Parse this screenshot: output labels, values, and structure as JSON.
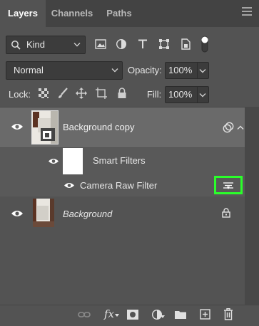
{
  "tabs": [
    {
      "label": "Layers",
      "active": true
    },
    {
      "label": "Channels",
      "active": false
    },
    {
      "label": "Paths",
      "active": false
    }
  ],
  "filter": {
    "kind_label": "Kind"
  },
  "blend": {
    "mode": "Normal",
    "opacity_label": "Opacity:",
    "opacity_value": "100%"
  },
  "lock": {
    "label": "Lock:",
    "fill_label": "Fill:",
    "fill_value": "100%"
  },
  "layers": {
    "background_copy": "Background copy",
    "smart_filters": "Smart Filters",
    "camera_raw": "Camera Raw Filter",
    "background": "Background"
  },
  "bottom": {
    "fx": "fx"
  },
  "colors": {
    "highlight": "#2aff2a",
    "panel": "#535353",
    "selected_row": "#6a6a6a"
  }
}
